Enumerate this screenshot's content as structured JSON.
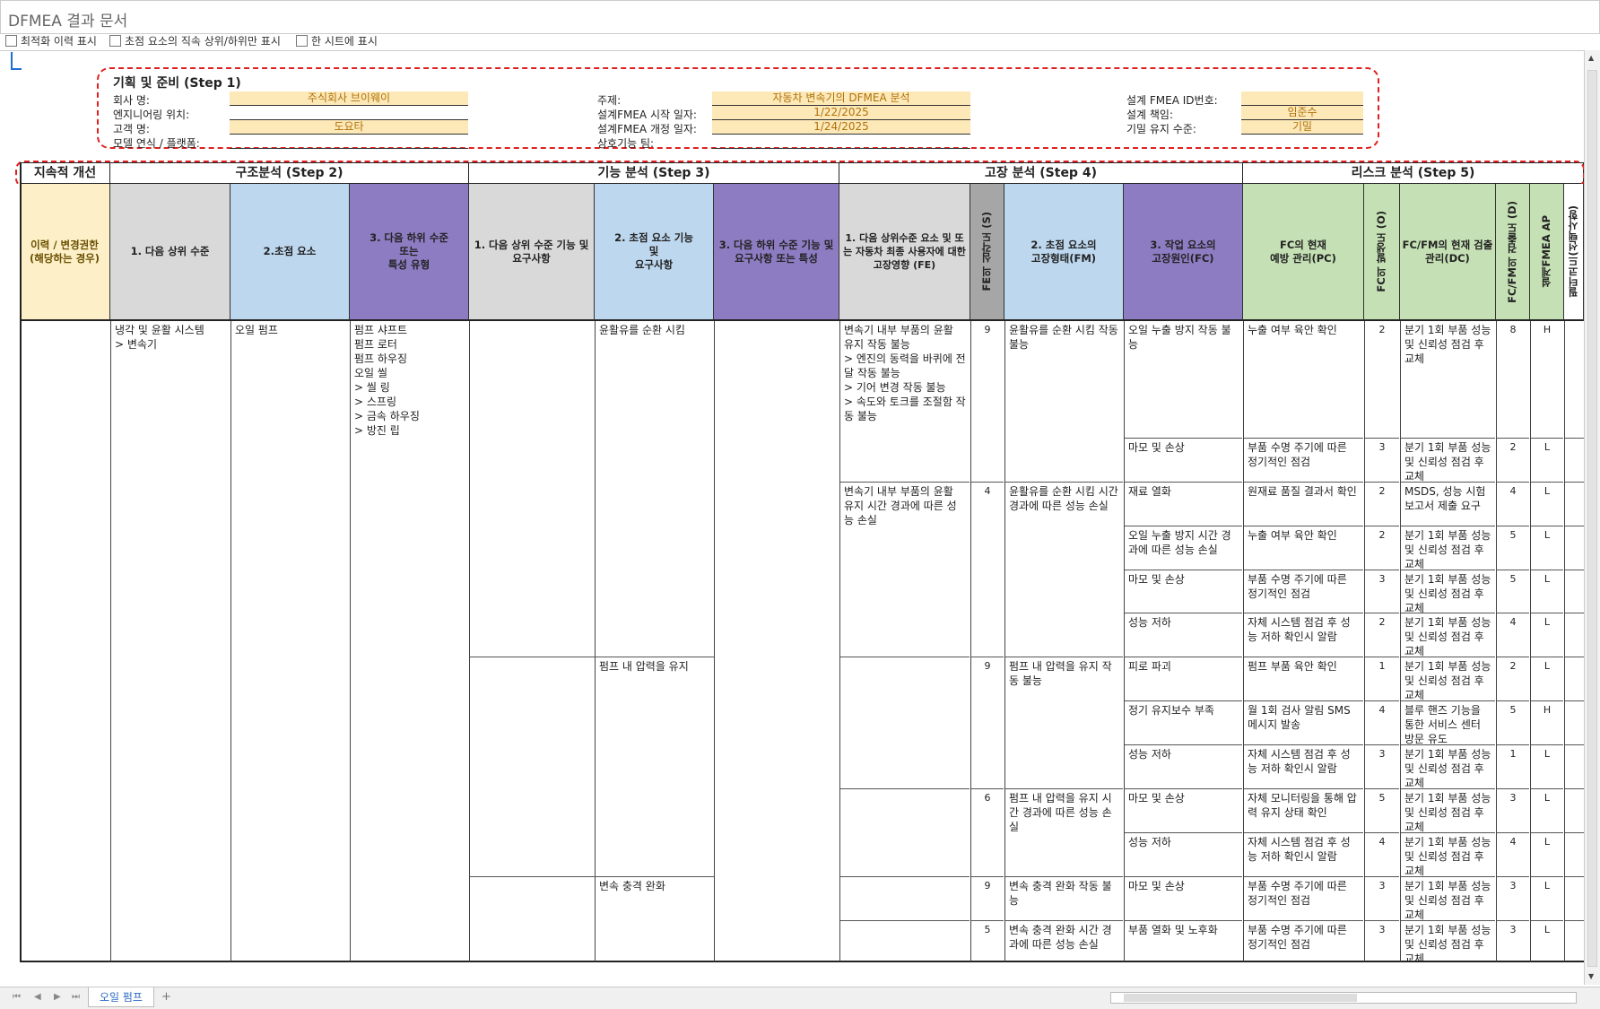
{
  "window": {
    "title": "DFMEA 결과 문서"
  },
  "options": [
    {
      "label": "최적화 이력 표시"
    },
    {
      "label": "초점 요소의 직속 상위/하위만 표시"
    },
    {
      "label": "한 시트에 표시"
    }
  ],
  "step1": {
    "title": "기획 및 준비 (Step 1)",
    "fields": {
      "company_label": "회사 명:",
      "company_value": "주식회사 브이웨이",
      "location_label": "엔지니어링 위치:",
      "location_value": "",
      "customer_label": "고객 명:",
      "customer_value": "도요타",
      "model_label": "모델 연식 / 플랫폼:",
      "model_value": "",
      "subject_label": "주제:",
      "subject_value": "자동차 변속기의 DFMEA 분석",
      "start_label": "설계FMEA 시작 일자:",
      "start_value": "1/22/2025",
      "rev_label": "설계FMEA 개정 일자:",
      "rev_value": "1/24/2025",
      "team_label": "상호기능 팀:",
      "team_value": "",
      "id_label": "설계 FMEA ID번호:",
      "id_value": "",
      "owner_label": "설계 책임:",
      "owner_value": "임준수",
      "conf_label": "기밀 유지 수준:",
      "conf_value": "기밀"
    }
  },
  "sections": {
    "s0": "지속적 개선",
    "s2": "구조분석 (Step 2)",
    "s3": "기능 분석 (Step 3)",
    "s4": "고장 분석 (Step 4)",
    "s5": "리스크 분석 (Step 5)"
  },
  "headers": {
    "h0": "이력 / 변경권한\n(해당하는 경우)",
    "h1": "1. 다음 상위 수준",
    "h2": "2.초점 요소",
    "h3": "3. 다음 하위 수준\n또는\n특성 유형",
    "h4": "1. 다음 상위 수준 기능 및 요구사항",
    "h5": "2. 초점 요소 기능\n및\n요구사항",
    "h6": "3. 다음 하위 수준 기능 및 요구사항 또는 특성",
    "h7": "1. 다음 상위수준 요소 및 또는 자동차 최종 사용자에 대한 고장영향 (FE)",
    "h8": "FE의 심각도 (S)",
    "h9": "2. 초점 요소의\n고장형태(FM)",
    "h10": "3. 작업 요소의\n고장원인(FC)",
    "h11": "FC의 현재\n예방 관리(PC)",
    "h12": "FC의 발생도 (O)",
    "h13": "FC/FM의 현재 검출 관리(DC)",
    "h14": "FC/FM의 검출도 (D)",
    "h15": "설계FMEA AP",
    "h16": "필터코드(선택사항)"
  },
  "structure": {
    "upper": "냉각 및 윤활 시스템\n  > 변속기",
    "focus": "오일 펌프",
    "lower": "펌프 샤프트\n펌프 로터\n펌프 하우징\n오일 씰\n  > 씰 링\n  > 스프링\n  > 금속 하우징\n  > 방진 립"
  },
  "functions": [
    {
      "text": "윤활유를 순환 시킴"
    },
    {
      "text": "펌프 내 압력을 유지"
    },
    {
      "text": "변속 충격 완화"
    }
  ],
  "effects": [
    {
      "text": "변속기 내부 부품의 윤활 유지 작동 불능\n  > 엔진의 동력을 바퀴에 전달 작동 불능\n  > 기어 변경 작동 불능\n  > 속도와 토크를 조절함 작동 불능",
      "s": "9"
    },
    {
      "text": "변속기 내부 부품의 윤활 유지 시간 경과에 따른 성능 손실",
      "s": "4"
    },
    {
      "text": "",
      "s": "9"
    },
    {
      "text": "",
      "s": "6"
    },
    {
      "text": "",
      "s": "9"
    },
    {
      "text": "",
      "s": "5"
    }
  ],
  "modes": [
    {
      "text": "윤활유를 순환 시킴 작동 불능"
    },
    {
      "text": "윤활유를 순환 시킴 시간 경과에 따른 성능 손실"
    },
    {
      "text": "펌프 내 압력을 유지 작동 불능"
    },
    {
      "text": "펌프 내 압력을 유지 시간 경과에 따른 성능 손실"
    },
    {
      "text": "변속 충격 완화 작동 불능"
    },
    {
      "text": "변속 충격 완화 시간 경과에 따른 성능 손실"
    }
  ],
  "causes": [
    {
      "fc": "오일 누출 방지 작동 불능",
      "pc": "누출 여부 육안 확인",
      "o": "2",
      "dc": "분기 1회 부품 성능 및 신뢰성 점검 후 교체",
      "d": "8",
      "ap": "H"
    },
    {
      "fc": "마모 및 손상",
      "pc": "부품 수명 주기에 따른 정기적인 점검",
      "o": "3",
      "dc": "분기 1회 부품 성능 및 신뢰성 점검 후 교체",
      "d": "2",
      "ap": "L"
    },
    {
      "fc": "재료 열화",
      "pc": "원재료 품질 결과서 확인",
      "o": "2",
      "dc": "MSDS, 성능 시험 보고서 제출 요구",
      "d": "4",
      "ap": "L"
    },
    {
      "fc": "오일 누출 방지 시간 경과에 따른 성능 손실",
      "pc": "누출 여부 육안 확인",
      "o": "2",
      "dc": "분기 1회 부품 성능 및 신뢰성 점검 후 교체",
      "d": "5",
      "ap": "L"
    },
    {
      "fc": "마모 및 손상",
      "pc": "부품 수명 주기에 따른 정기적인 점검",
      "o": "3",
      "dc": "분기 1회 부품 성능 및 신뢰성 점검 후 교체",
      "d": "5",
      "ap": "L"
    },
    {
      "fc": "성능 저하",
      "pc": "자체 시스템 점검 후 성능 저하 확인시 알람",
      "o": "2",
      "dc": "분기 1회 부품 성능 및 신뢰성 점검 후 교체",
      "d": "4",
      "ap": "L"
    },
    {
      "fc": "피로 파괴",
      "pc": "펌프 부품 육안 확인",
      "o": "1",
      "dc": "분기 1회 부품 성능 및 신뢰성 점검 후 교체",
      "d": "2",
      "ap": "L"
    },
    {
      "fc": "정기 유지보수 부족",
      "pc": "월 1회 검사 알림 SMS 메시지 발송",
      "o": "4",
      "dc": "블루 핸즈 기능을 통한 서비스 센터 방문 유도",
      "d": "5",
      "ap": "H"
    },
    {
      "fc": "성능 저하",
      "pc": "자체 시스템 점검 후 성능 저하 확인시 알람",
      "o": "3",
      "dc": "분기 1회 부품 성능 및 신뢰성 점검 후 교체",
      "d": "1",
      "ap": "L"
    },
    {
      "fc": "마모 및 손상",
      "pc": "자체 모니터링을 통해 압력 유지 상태 확인",
      "o": "5",
      "dc": "분기 1회 부품 성능 및 신뢰성 점검 후 교체",
      "d": "3",
      "ap": "L"
    },
    {
      "fc": "성능 저하",
      "pc": "자체 시스템 점검 후 성능 저하 확인시 알람",
      "o": "4",
      "dc": "분기 1회 부품 성능 및 신뢰성 점검 후 교체",
      "d": "4",
      "ap": "L"
    },
    {
      "fc": "마모 및 손상",
      "pc": "부품 수명 주기에 따른 정기적인 점검",
      "o": "3",
      "dc": "분기 1회 부품 성능 및 신뢰성 점검 후 교체",
      "d": "3",
      "ap": "L"
    },
    {
      "fc": "부품 열화 및 노후화",
      "pc": "부품 수명 주기에 따른 정기적인 점검",
      "o": "3",
      "dc": "분기 1회 부품 성능 및 신뢰성 점검 후 교체",
      "d": "3",
      "ap": "L"
    }
  ],
  "sheet_tabs": [
    {
      "label": "오일 펌프"
    }
  ],
  "add_tab": "+",
  "colors": {
    "yellow": "#fdf0c8",
    "gray": "#d9d9d9",
    "blue": "#bdd7ee",
    "purple": "#8e7cc3",
    "green": "#c5e0b4",
    "darkgray": "#a6a6a6",
    "dash": "#e02020"
  }
}
